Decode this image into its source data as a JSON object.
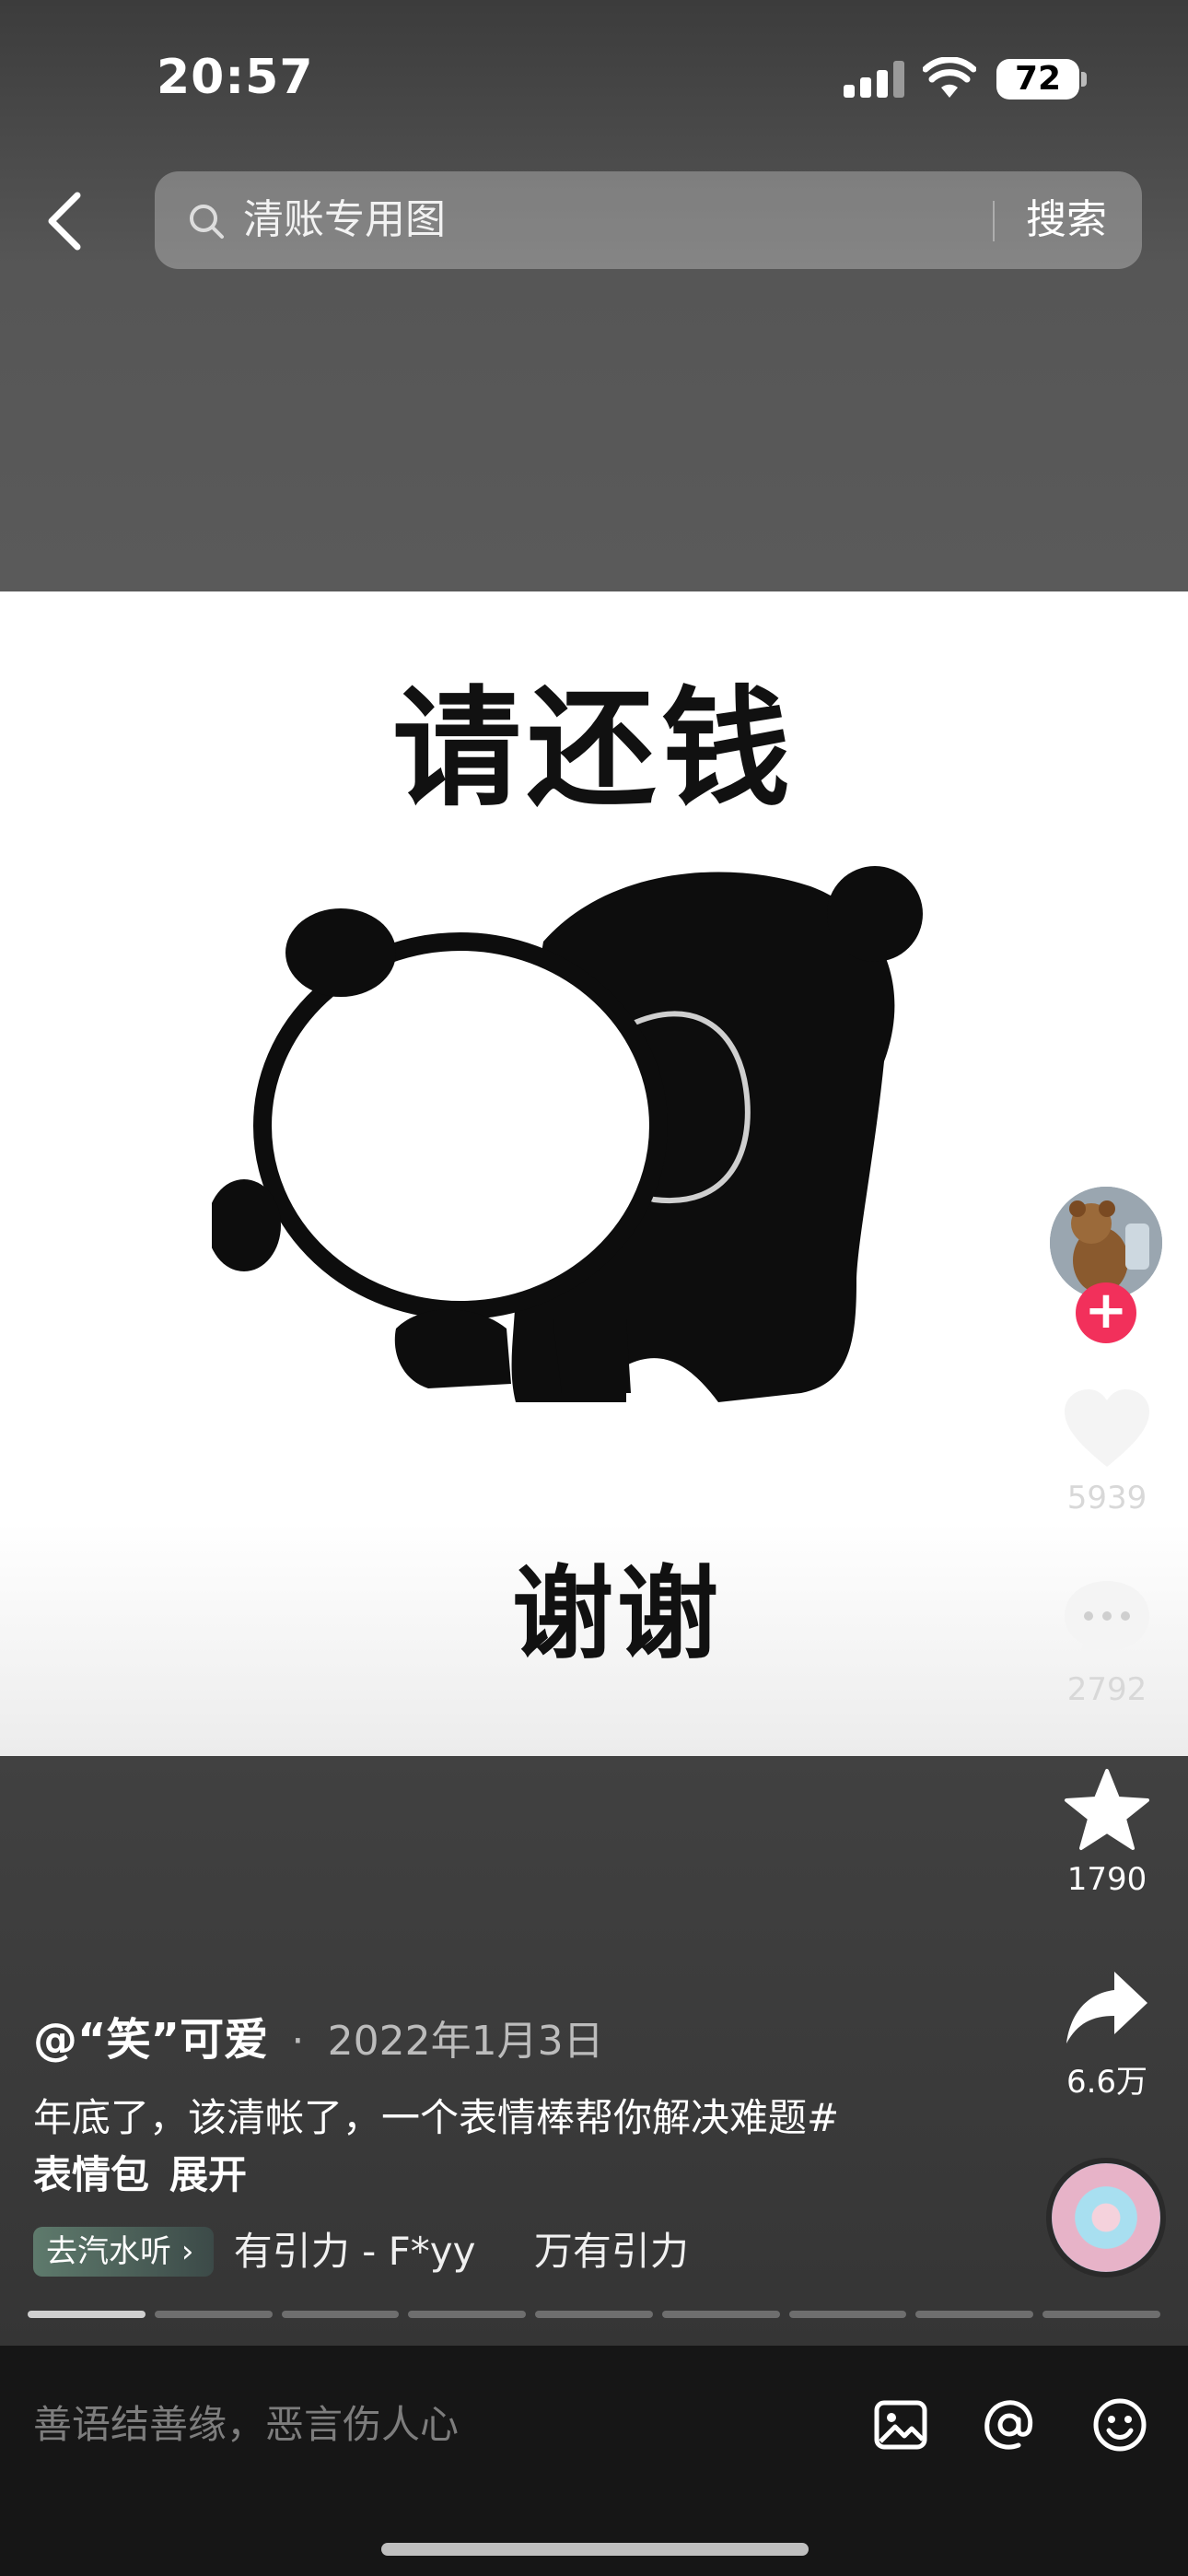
{
  "status_bar": {
    "time": "20:57",
    "battery": "72"
  },
  "search": {
    "query": "清账专用图",
    "button_label": "搜索"
  },
  "meme": {
    "top_text": "请还钱",
    "bottom_text": "谢谢"
  },
  "actions": {
    "likes": "5939",
    "comments": "2792",
    "favorites": "1790",
    "shares": "6.6万",
    "follow_symbol": "+"
  },
  "post": {
    "author": "@“笑”可爱",
    "date_separator": "·",
    "date": "2022年1月3日",
    "caption": "年底了，该清帐了，一个表情棒帮你解决难题#",
    "tag": "表情包",
    "expand_label": "展开"
  },
  "music": {
    "badge": "去汽水听",
    "title": "有引力 - F*yy",
    "album": "万有引力"
  },
  "progress": {
    "segments": 9,
    "active_index": 0
  },
  "comment_bar": {
    "placeholder": "善语结善缘，恶言伤人心"
  },
  "colors": {
    "follow": "#f2305b",
    "background": "#3b3b3b",
    "comment_bar": "#161616"
  },
  "icons": [
    "back-icon",
    "search-icon",
    "heart-icon",
    "comment-icon",
    "star-icon",
    "share-icon",
    "image-icon",
    "at-icon",
    "emoji-icon",
    "chevron-right-icon"
  ]
}
